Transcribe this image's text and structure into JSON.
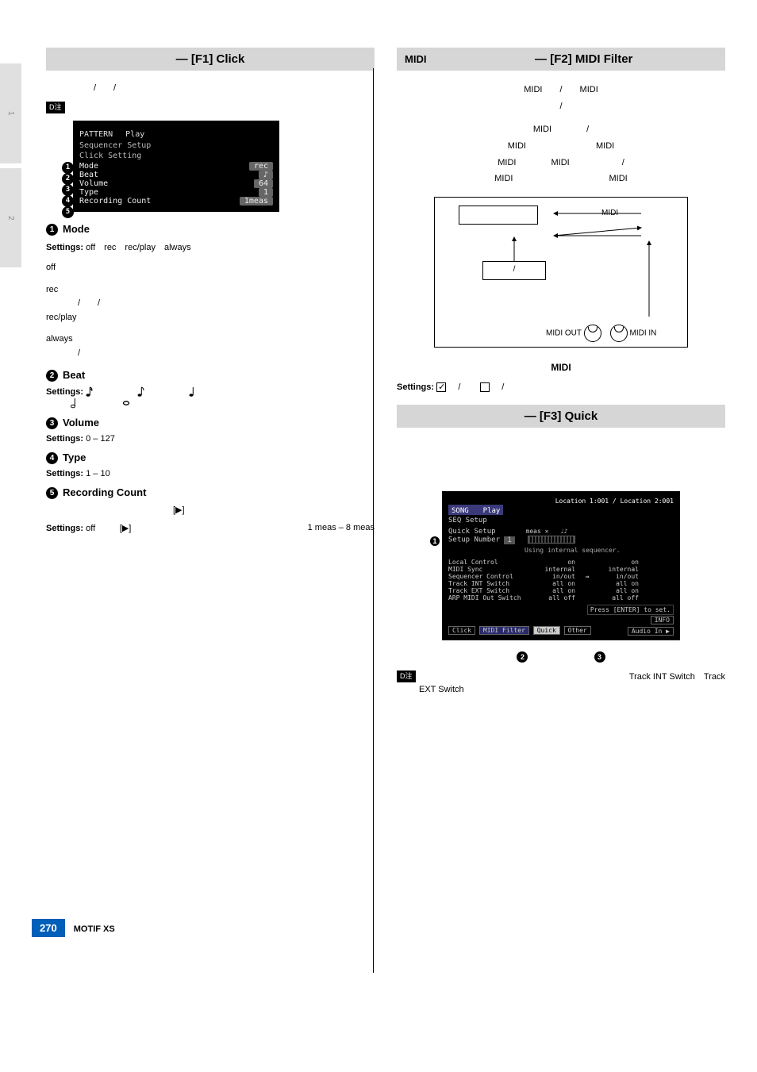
{
  "sidebar": {
    "tab1": "1",
    "tab2": "2"
  },
  "left": {
    "header": {
      "title": "— [F1] Click"
    },
    "intro": "/　　/",
    "screen1": {
      "top1": "PATTERN　 Play",
      "top2": "Sequencer Setup",
      "top3": "Click Setting",
      "rows": [
        {
          "n": "1",
          "k": "Mode",
          "v": "rec"
        },
        {
          "n": "2",
          "k": "Beat",
          "v": "♪"
        },
        {
          "n": "3",
          "k": "Volume",
          "v": "64"
        },
        {
          "n": "4",
          "k": "Type",
          "v": "1"
        },
        {
          "n": "5",
          "k": "Recording Count",
          "v": "1meas"
        }
      ]
    },
    "s1": {
      "num": "1",
      "title": "Mode",
      "settings_label": "Settings:",
      "settings": "off　rec　rec/play　always",
      "opts": [
        {
          "k": "off",
          "v": ""
        },
        {
          "k": "rec",
          "v": "/　　/"
        },
        {
          "k": "rec/play",
          "v": ""
        },
        {
          "k": "always",
          "v": "/"
        }
      ]
    },
    "s2": {
      "num": "2",
      "title": "Beat",
      "settings_label": "Settings:"
    },
    "s3": {
      "num": "3",
      "title": "Volume",
      "settings_label": "Settings:",
      "settings": "0 – 127"
    },
    "s4": {
      "num": "4",
      "title": "Type",
      "settings_label": "Settings:",
      "settings": "1 – 10"
    },
    "s5": {
      "num": "5",
      "title": "Recording Count",
      "desc": "[▶]",
      "settings_label": "Settings:",
      "settings_a": "off",
      "settings_b": "[▶]",
      "settings_c": "1 meas – 8 meas"
    }
  },
  "right": {
    "header1": {
      "pre": "MIDI",
      "title": "— [F2] MIDI Filter"
    },
    "p1": "MIDI　　/　　MIDI",
    "p1b": "/",
    "p2a": "MIDI　　　　/",
    "p2b": "MIDI　　　　　　　　MIDI",
    "p2c": "MIDI　　　　MIDI　　　　　　/",
    "p2d": "MIDI　　　　　　　　　　　MIDI",
    "diagram": {
      "midi_label": "MIDI",
      "box1": "/",
      "out": "MIDI OUT",
      "in": "MIDI IN"
    },
    "midi_center": "MIDI",
    "settings_label": "Settings:",
    "settings_on": "/",
    "settings_off": "/",
    "header2": {
      "title": "— [F3] Quick"
    },
    "screen2": {
      "loc": "Location 1:001 / Location 2:001",
      "top1": "SONG　　Play",
      "top2": "SEQ Setup",
      "qs": "Quick Setup",
      "sn": "Setup Number",
      "snv": "1",
      "use": "Using internal sequencer.",
      "rows": [
        {
          "k": "Local Control",
          "a": "on",
          "b": "on"
        },
        {
          "k": "MIDI Sync",
          "a": "internal",
          "b": "internal"
        },
        {
          "k": "Sequencer Control",
          "a": "in/out",
          "b": "in/out"
        },
        {
          "k": "Track INT Switch",
          "a": "all on",
          "b": "all on"
        },
        {
          "k": "Track EXT Switch",
          "a": "all on",
          "b": "all on"
        },
        {
          "k": "ARP MIDI Out Switch",
          "a": "all off",
          "b": "all off"
        }
      ],
      "hint": "Press [ENTER] to set.",
      "info": "INFO",
      "tabs": [
        "Click",
        "MIDI Filter",
        "Quick",
        "Other"
      ],
      "audio": "Audio In ▶",
      "b1": "1",
      "b2": "2",
      "b3": "3"
    },
    "note_txt1": "Track INT Switch　Track",
    "note_txt2": "EXT Switch"
  },
  "footer": {
    "page": "270",
    "book": "MOTIF XS"
  }
}
